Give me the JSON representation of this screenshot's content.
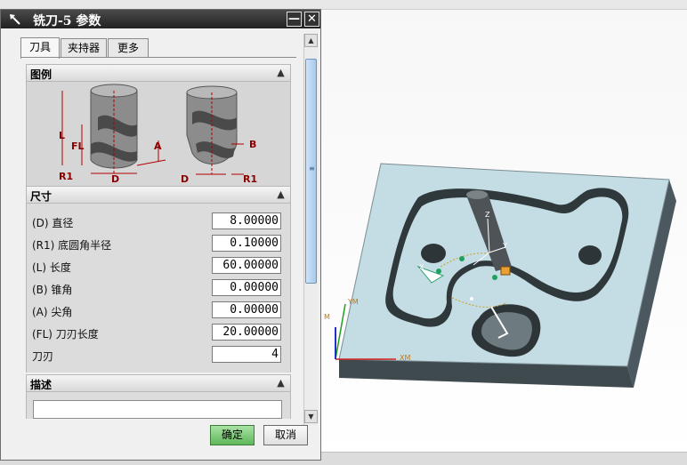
{
  "dialog": {
    "title": "铣刀-5 参数",
    "close_symbol": "✕",
    "minimize_symbol": "—"
  },
  "tabs": [
    {
      "label": "刀具",
      "active": true
    },
    {
      "label": "夹持器",
      "active": false
    },
    {
      "label": "更多",
      "active": false
    }
  ],
  "sections": {
    "illustration": {
      "title": "图例"
    },
    "dimensions": {
      "title": "尺寸"
    },
    "description": {
      "title": "描述"
    }
  },
  "illustration_labels": {
    "L": "L",
    "FL": "FL",
    "R1_left": "R1",
    "D_left": "D",
    "A": "A",
    "B": "B",
    "D_right": "D",
    "R1_right": "R1"
  },
  "parameters": [
    {
      "label": "(D) 直径",
      "value": "8.00000"
    },
    {
      "label": "(R1) 底圆角半径",
      "value": "0.10000"
    },
    {
      "label": "(L) 长度",
      "value": "60.00000"
    },
    {
      "label": "(B) 锥角",
      "value": "0.00000"
    },
    {
      "label": "(A) 尖角",
      "value": "0.00000"
    },
    {
      "label": "(FL) 刀刃长度",
      "value": "20.00000"
    },
    {
      "label": "刀刃",
      "value": "4"
    }
  ],
  "buttons": {
    "ok": "确定",
    "cancel": "取消"
  },
  "viewport_labels": {
    "axis_ym": "YM",
    "axis_xm": "XM",
    "axis_m": "M",
    "tool_z": "Z",
    "tool_y": "Y",
    "tool_x": "X"
  },
  "colors": {
    "ok_button": "#5fb759",
    "workpiece": "#c4dde4",
    "axis_x": "#d42020",
    "axis_y": "#20a020",
    "axis_z": "#2030d0"
  }
}
